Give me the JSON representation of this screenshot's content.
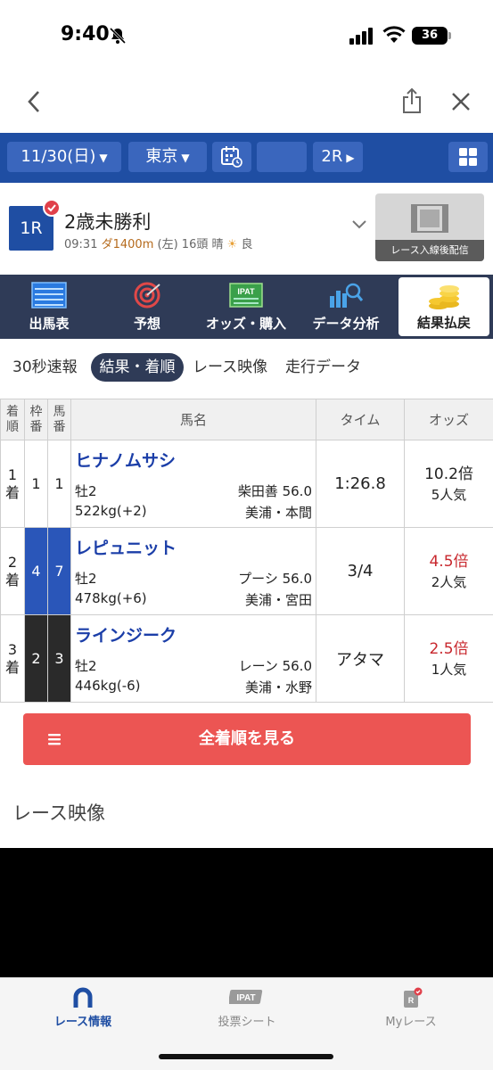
{
  "status_bar": {
    "time": "9:40",
    "battery": "36"
  },
  "selector": {
    "date": "11/30(日)",
    "venue": "東京",
    "race": "2R",
    "icons": [
      "calendar-icon",
      "grid-icon"
    ]
  },
  "race": {
    "badge": "1R",
    "title": "2歳未勝利",
    "start_time": "09:31",
    "course": "ダ1400m",
    "direction": "(左)",
    "runners": "16頭",
    "weather": "晴",
    "going": "良",
    "video_caption": "レース入線後配信"
  },
  "menu": [
    {
      "label": "出馬表",
      "icon": "entry-list-icon"
    },
    {
      "label": "予想",
      "icon": "target-icon"
    },
    {
      "label": "オッズ・購入",
      "icon": "ipat-icon"
    },
    {
      "label": "データ分析",
      "icon": "chart-search-icon"
    },
    {
      "label": "結果払戻",
      "icon": "coins-icon",
      "active": true
    }
  ],
  "sub_tabs": [
    "30秒速報",
    "結果・着順",
    "レース映像",
    "走行データ"
  ],
  "sub_tab_active": "結果・着順",
  "table": {
    "headers": {
      "rank": [
        "着",
        "順"
      ],
      "frame": [
        "枠",
        "番"
      ],
      "num": [
        "馬",
        "番"
      ],
      "name": "馬名",
      "time": "タイム",
      "odds": "オッズ"
    },
    "rows": [
      {
        "rank_a": "1",
        "rank_b": "着",
        "frame": "1",
        "num": "1",
        "name": "ヒナノムサシ",
        "sex_age": "牡2",
        "jockey": "柴田善 56.0",
        "weight": "522kg(+2)",
        "trainer": "美浦・本間",
        "time": "1:26.8",
        "odds": "10.2倍",
        "popularity": "5人気"
      },
      {
        "rank_a": "2",
        "rank_b": "着",
        "frame": "4",
        "num": "7",
        "name": "レピュニット",
        "sex_age": "牡2",
        "jockey": "プーシ 56.0",
        "weight": "478kg(+6)",
        "trainer": "美浦・宮田",
        "time": "3/4",
        "odds": "4.5倍",
        "popularity": "2人気"
      },
      {
        "rank_a": "3",
        "rank_b": "着",
        "frame": "2",
        "num": "3",
        "name": "ラインジーク",
        "sex_age": "牡2",
        "jockey": "レーン 56.0",
        "weight": "446kg(-6)",
        "trainer": "美浦・水野",
        "time": "アタマ",
        "odds": "2.5倍",
        "popularity": "1人気"
      }
    ]
  },
  "full_order_button": "全着順を見る",
  "video_section_title": "レース映像",
  "bottom_nav": [
    {
      "label": "レース情報",
      "icon": "horseshoe-icon",
      "active": true
    },
    {
      "label": "投票シート",
      "icon": "ipat-sheet-icon",
      "badge_text": "IPAT"
    },
    {
      "label": "Myレース",
      "icon": "my-race-icon",
      "badge_text": "R"
    }
  ],
  "colors": {
    "brand_blue": "#1f4ea3",
    "menu_navy": "#2f3b57",
    "accent_red": "#ec5553",
    "odds_red": "#c8282e"
  }
}
